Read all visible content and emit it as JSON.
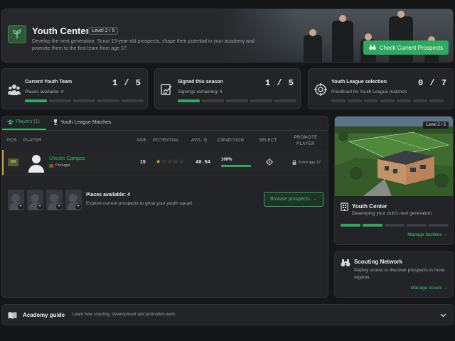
{
  "header": {
    "title": "Youth Center",
    "level_badge": "Level 2 / 5",
    "description": "Develop the next generation. Scout 15-year-old prospects, shape their potential in your academy and promote them to the first team from age 17.",
    "cta_label": "Check Current Prospects",
    "cta_icon": "binoculars-icon"
  },
  "stats": [
    {
      "label": "Current Youth Team",
      "value": "1 / 5",
      "sub": "Places available: 4",
      "icon": "team-icon",
      "filled": 1,
      "total": 5
    },
    {
      "label": "Signed this season",
      "value": "1 / 5",
      "sub": "Signings remaining: 4",
      "icon": "signature-icon",
      "filled": 1,
      "total": 5
    },
    {
      "label": "Youth League selection",
      "value": "0 / 7",
      "sub": "Prioritised for Youth League matches",
      "icon": "target-icon",
      "filled": 0,
      "total": 7
    }
  ],
  "tabs": [
    {
      "label": "Players (1)",
      "active": true,
      "icon": "players-icon"
    },
    {
      "label": "Youth League Matches",
      "active": false,
      "icon": "trophy-icon"
    }
  ],
  "table": {
    "headers": {
      "pos": "POS",
      "player": "PLAYER",
      "age": "AGE",
      "potential": "POTENTIAL",
      "avg": "AVG. Q.",
      "condition": "CONDITION",
      "select": "SELECT",
      "promote": "PROMOTE PLAYER"
    },
    "rows": [
      {
        "pos": "DR",
        "first_name": "Ulisses",
        "last_name": "Campos",
        "country": "Portugal",
        "age": "15",
        "potential_stars": 1,
        "potential_max": 5,
        "avg": "40.54",
        "condition": "100%",
        "condition_value": 1.0,
        "promote": "From age 17"
      }
    ]
  },
  "empty_slots": 4,
  "places": {
    "title": "Places available: 4",
    "text": "Explore current prospects to grow your youth squad.",
    "button": "Browse prospects"
  },
  "youth_center_card": {
    "badge": "Level 2 / 5",
    "title": "Youth Center",
    "description": "Developing your club's next generation.",
    "filled": 2,
    "total": 5,
    "link": "Manage facilities"
  },
  "scouting": {
    "title": "Scouting Network",
    "description": "Deploy scouts to discover prospects in more regions.",
    "link": "Manage scouts"
  },
  "guide": {
    "title": "Academy guide",
    "description": "Learn how scouting, development and promotion work."
  },
  "colors": {
    "accent": "#2fa860",
    "background": "#151618",
    "panel": "#222427",
    "star": "#e7b72e"
  }
}
